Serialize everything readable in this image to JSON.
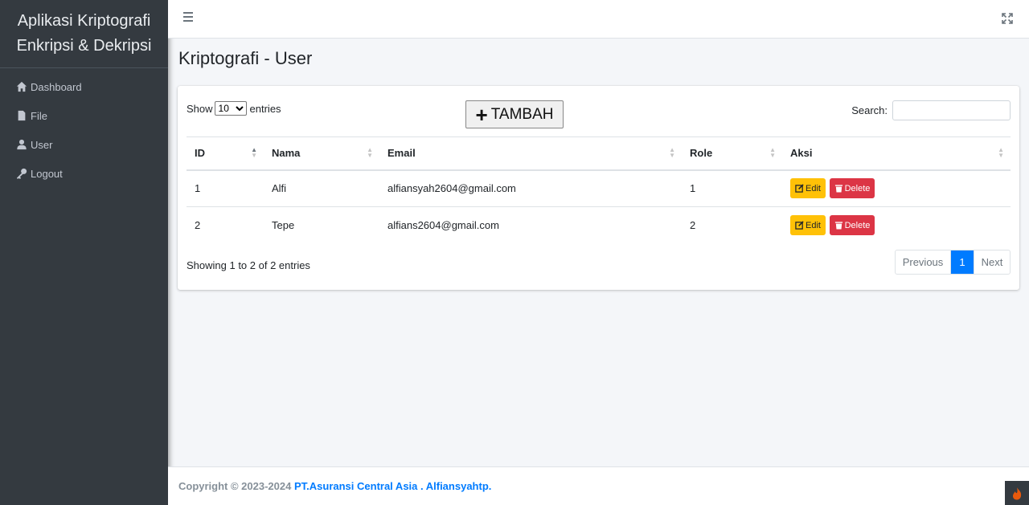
{
  "app": {
    "brand_line1": "Aplikasi Kriptografi",
    "brand_line2": "Enkripsi & Dekripsi"
  },
  "sidebar": {
    "items": [
      {
        "label": "Dashboard",
        "icon": "home-icon"
      },
      {
        "label": "File",
        "icon": "file-icon"
      },
      {
        "label": "User",
        "icon": "user-icon"
      },
      {
        "label": "Logout",
        "icon": "key-icon"
      }
    ]
  },
  "page": {
    "title": "Kriptografi - User"
  },
  "controls": {
    "show_label": "Show",
    "entries_label": "entries",
    "page_length": "10",
    "add_button": "TAMBAH",
    "search_label": "Search:",
    "search_value": ""
  },
  "table": {
    "headers": [
      "ID",
      "Nama",
      "Email",
      "Role",
      "Aksi"
    ],
    "rows": [
      {
        "id": "1",
        "nama": "Alfi",
        "email": "alfiansyah2604@gmail.com",
        "role": "1"
      },
      {
        "id": "2",
        "nama": "Tepe",
        "email": "alfians2604@gmail.com",
        "role": "2"
      }
    ],
    "edit_label": "Edit",
    "delete_label": "Delete"
  },
  "pagination": {
    "info": "Showing 1 to 2 of 2 entries",
    "previous": "Previous",
    "current": "1",
    "next": "Next"
  },
  "footer": {
    "prefix": "Copyright © 2023-2024",
    "link": "PT.Asuransi Central Asia . Alfiansyahtp."
  },
  "colors": {
    "sidebar": "#343a40",
    "primary": "#007bff",
    "warning": "#ffc107",
    "danger": "#dc3545"
  }
}
